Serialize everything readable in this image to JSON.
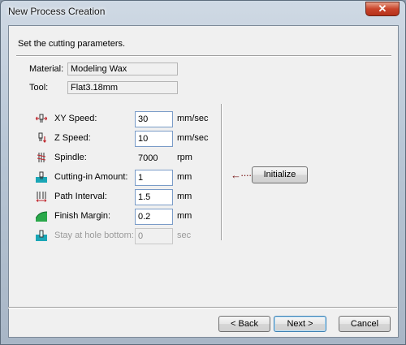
{
  "window": {
    "title": "New Process Creation",
    "close_glyph": "✕"
  },
  "instruction": "Set the cutting parameters.",
  "info": {
    "material_label": "Material:",
    "material_value": "Modeling Wax",
    "tool_label": "Tool:",
    "tool_value": "Flat3.18mm"
  },
  "params": [
    {
      "icon": "xy-speed-icon",
      "label": "XY Speed:",
      "value": "30",
      "unit": "mm/sec",
      "state": "editable"
    },
    {
      "icon": "z-speed-icon",
      "label": "Z Speed:",
      "value": "10",
      "unit": "mm/sec",
      "state": "editable"
    },
    {
      "icon": "spindle-icon",
      "label": "Spindle:",
      "value": "7000",
      "unit": "rpm",
      "state": "readonly"
    },
    {
      "icon": "cutting-in-icon",
      "label": "Cutting-in Amount:",
      "value": "1",
      "unit": "mm",
      "state": "editable"
    },
    {
      "icon": "path-interval-icon",
      "label": "Path Interval:",
      "value": "1.5",
      "unit": "mm",
      "state": "editable"
    },
    {
      "icon": "finish-margin-icon",
      "label": "Finish Margin:",
      "value": "0.2",
      "unit": "mm",
      "state": "editable"
    },
    {
      "icon": "stay-hole-icon",
      "label": "Stay at hole bottom:",
      "value": "0",
      "unit": "sec",
      "state": "disabled"
    }
  ],
  "initialize": {
    "arrow": "←·····",
    "label": "Initialize"
  },
  "footer": {
    "back_label": "< Back",
    "next_label": "Next >",
    "cancel_label": "Cancel"
  },
  "colors": {
    "accent": "#3c7fb1",
    "close": "#c9442b",
    "icon_teal": "#1aa6b6",
    "icon_red": "#c0262d"
  }
}
